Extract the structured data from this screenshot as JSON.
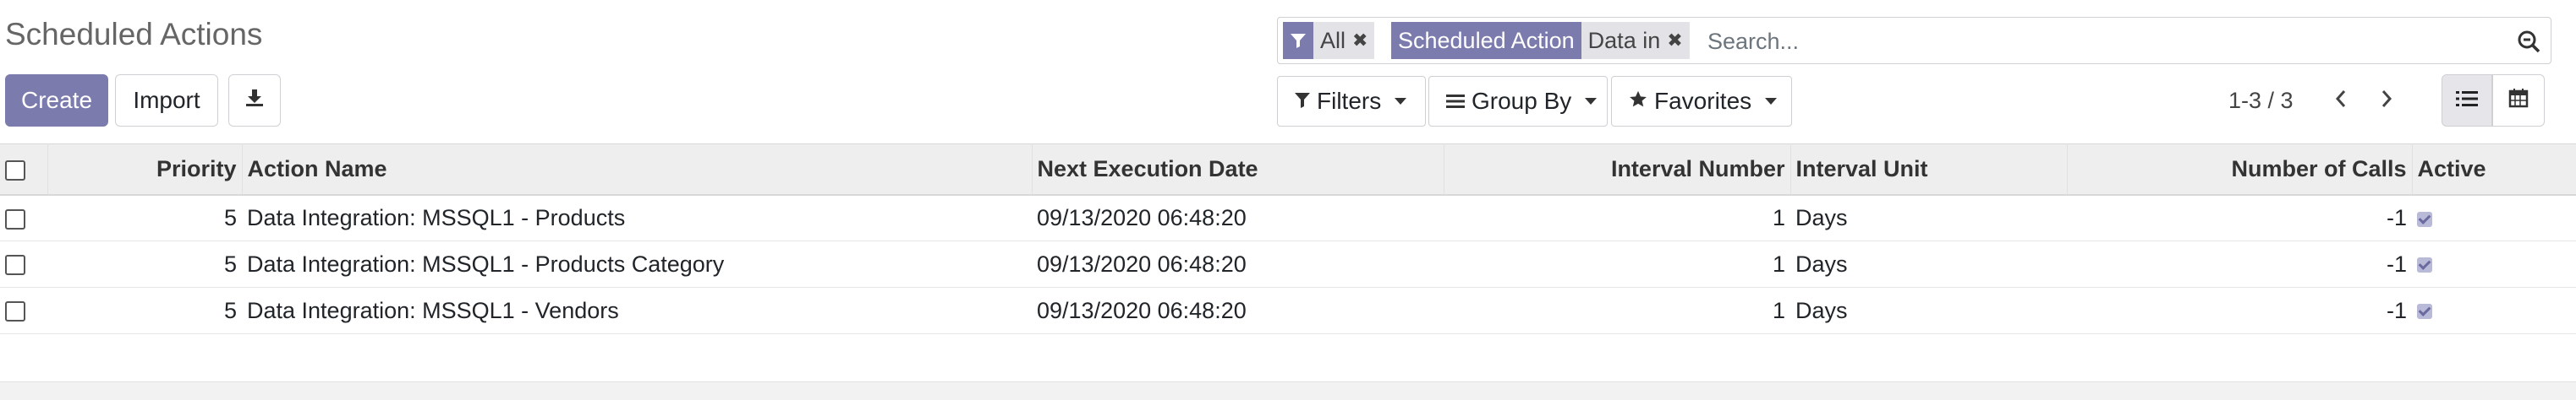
{
  "page": {
    "title": "Scheduled Actions"
  },
  "buttons": {
    "create": "Create",
    "import": "Import"
  },
  "search": {
    "facets": [
      {
        "values": [
          "All"
        ]
      },
      {
        "label": "Scheduled Action",
        "values": [
          "Data in"
        ]
      }
    ],
    "placeholder": "Search..."
  },
  "filters": {
    "filters_label": "Filters",
    "group_by_label": "Group By",
    "favorites_label": "Favorites"
  },
  "pager": {
    "text": "1-3 / 3"
  },
  "table": {
    "columns": [
      "Priority",
      "Action Name",
      "Next Execution Date",
      "Interval Number",
      "Interval Unit",
      "Number of Calls",
      "Active"
    ],
    "rows": [
      {
        "priority": "5",
        "name": "Data Integration: MSSQL1 - Products",
        "next_date": "09/13/2020 06:48:20",
        "interval_number": "1",
        "interval_unit": "Days",
        "calls": "-1",
        "active": true
      },
      {
        "priority": "5",
        "name": "Data Integration: MSSQL1 - Products Category",
        "next_date": "09/13/2020 06:48:20",
        "interval_number": "1",
        "interval_unit": "Days",
        "calls": "-1",
        "active": true
      },
      {
        "priority": "5",
        "name": "Data Integration: MSSQL1 - Vendors",
        "next_date": "09/13/2020 06:48:20",
        "interval_number": "1",
        "interval_unit": "Days",
        "calls": "-1",
        "active": true
      }
    ]
  },
  "colors": {
    "primary": "#7c7bad",
    "facet_bg": "#e2e2e7",
    "header_bg": "#eeeeee"
  },
  "icons": [
    "filter-icon",
    "remove-facet-icon",
    "search-icon",
    "download-icon",
    "list-lines-icon",
    "star-icon",
    "chevron-left-icon",
    "chevron-right-icon",
    "list-view-icon",
    "calendar-view-icon"
  ]
}
